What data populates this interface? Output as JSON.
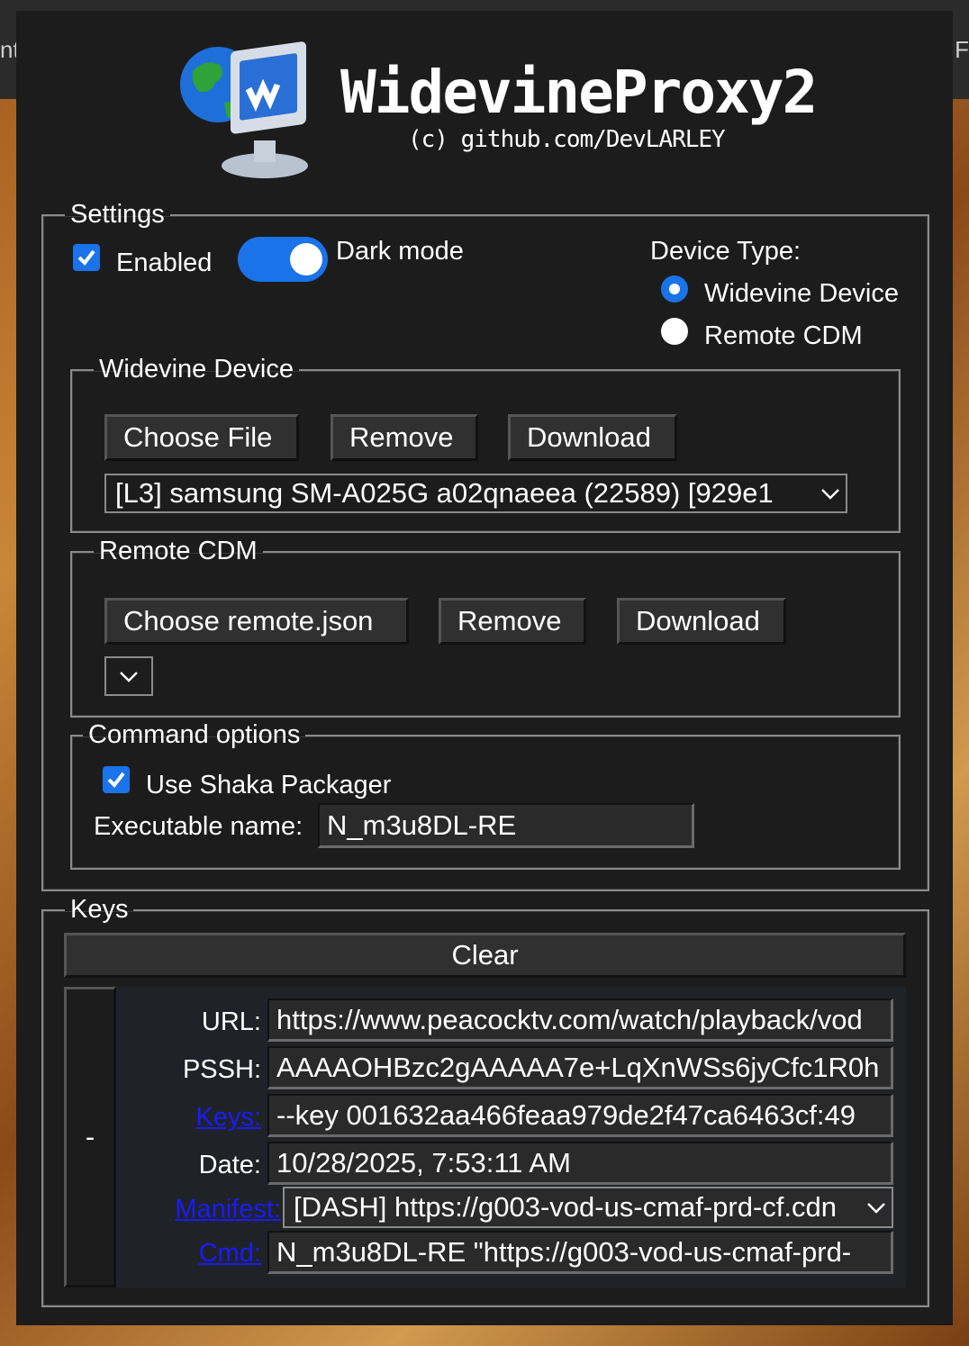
{
  "browser": {
    "edge_left": "nt",
    "edge_right": "F"
  },
  "header": {
    "title": "WidevineProxy2",
    "subtitle": "(c) github.com/DevLARLEY"
  },
  "settings": {
    "legend": "Settings",
    "enabled_label": "Enabled",
    "enabled_checked": true,
    "dark_mode_label": "Dark mode",
    "dark_mode_on": true,
    "device_type": {
      "label": "Device Type:",
      "options": [
        "Widevine Device",
        "Remote CDM"
      ],
      "selected": "Widevine Device"
    },
    "widevine_device": {
      "legend": "Widevine Device",
      "choose_label": "Choose File",
      "remove_label": "Remove",
      "download_label": "Download",
      "selected_device": "[L3] samsung SM-A025G a02qnaeea (22589) [929e1"
    },
    "remote_cdm": {
      "legend": "Remote CDM",
      "choose_label": "Choose remote.json",
      "remove_label": "Remove",
      "download_label": "Download",
      "selected_remote": ""
    },
    "command_options": {
      "legend": "Command options",
      "shaka_label": "Use Shaka Packager",
      "shaka_checked": true,
      "executable_label": "Executable name:",
      "executable_value": "N_m3u8DL-RE"
    }
  },
  "keys": {
    "legend": "Keys",
    "clear_label": "Clear",
    "collapse_label": "-",
    "entry": {
      "url_label": "URL:",
      "url_value": "https://www.peacocktv.com/watch/playback/vod",
      "pssh_label": "PSSH:",
      "pssh_value": "AAAAOHBzc2gAAAAA7e+LqXnWSs6jyCfc1R0h",
      "keys_label": "Keys:",
      "keys_value": "--key 001632aa466feaa979de2f47ca6463cf:49",
      "date_label": "Date:",
      "date_value": "10/28/2025, 7:53:11 AM",
      "manifest_label": "Manifest:",
      "manifest_value": "[DASH] https://g003-vod-us-cmaf-prd-cf.cdn",
      "cmd_label": "Cmd:",
      "cmd_value": "N_m3u8DL-RE \"https://g003-vod-us-cmaf-prd-"
    }
  },
  "colors": {
    "accent": "#1a73e8",
    "panel": "#1c1c1c",
    "link": "#1a1aff"
  }
}
